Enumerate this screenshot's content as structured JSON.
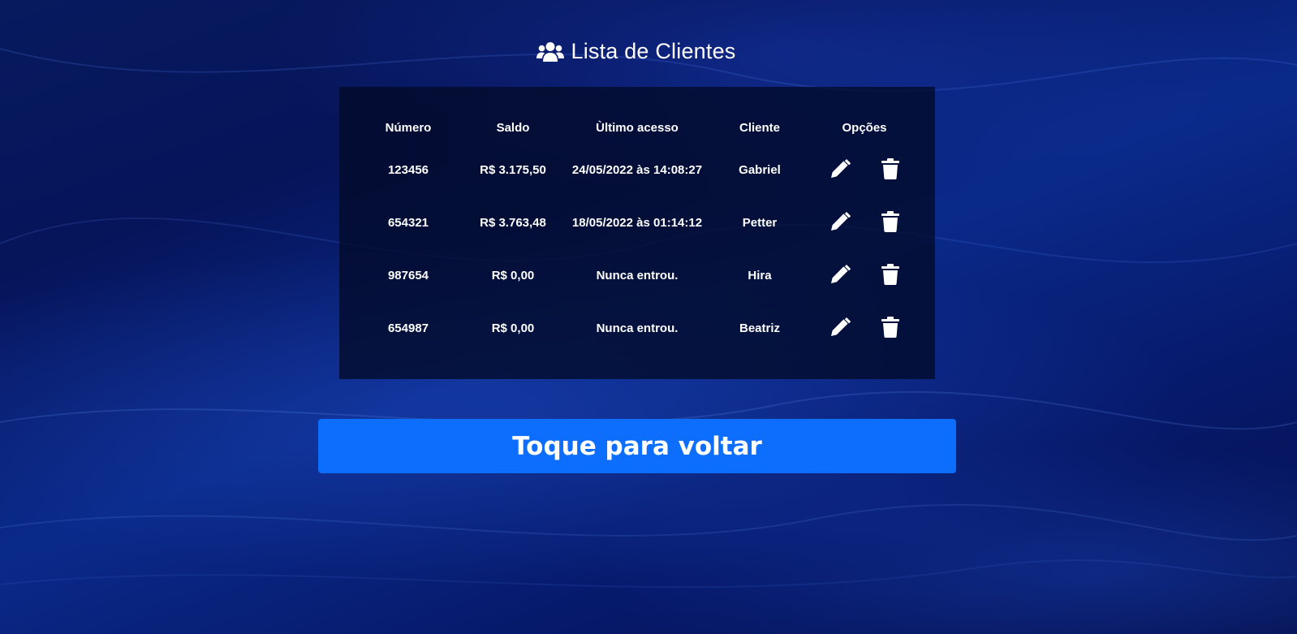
{
  "header": {
    "title": "Lista de Clientes",
    "icon": "users-icon"
  },
  "table": {
    "columns": [
      "Número",
      "Saldo",
      "Ùltimo acesso",
      "Cliente",
      "Opções"
    ],
    "rows": [
      {
        "numero": "123456",
        "saldo": "R$ 3.175,50",
        "ultimo_acesso": "24/05/2022 às 14:08:27",
        "cliente": "Gabriel"
      },
      {
        "numero": "654321",
        "saldo": "R$ 3.763,48",
        "ultimo_acesso": "18/05/2022 às 01:14:12",
        "cliente": "Petter"
      },
      {
        "numero": "987654",
        "saldo": "R$ 0,00",
        "ultimo_acesso": "Nunca entrou.",
        "cliente": "Hira"
      },
      {
        "numero": "654987",
        "saldo": "R$ 0,00",
        "ultimo_acesso": "Nunca entrou.",
        "cliente": "Beatriz"
      }
    ],
    "row_actions": [
      "pencil-icon",
      "trash-icon"
    ]
  },
  "footer": {
    "back_label": "Toque para voltar"
  },
  "colors": {
    "button": "#0d6efd",
    "text": "#ffffff"
  }
}
